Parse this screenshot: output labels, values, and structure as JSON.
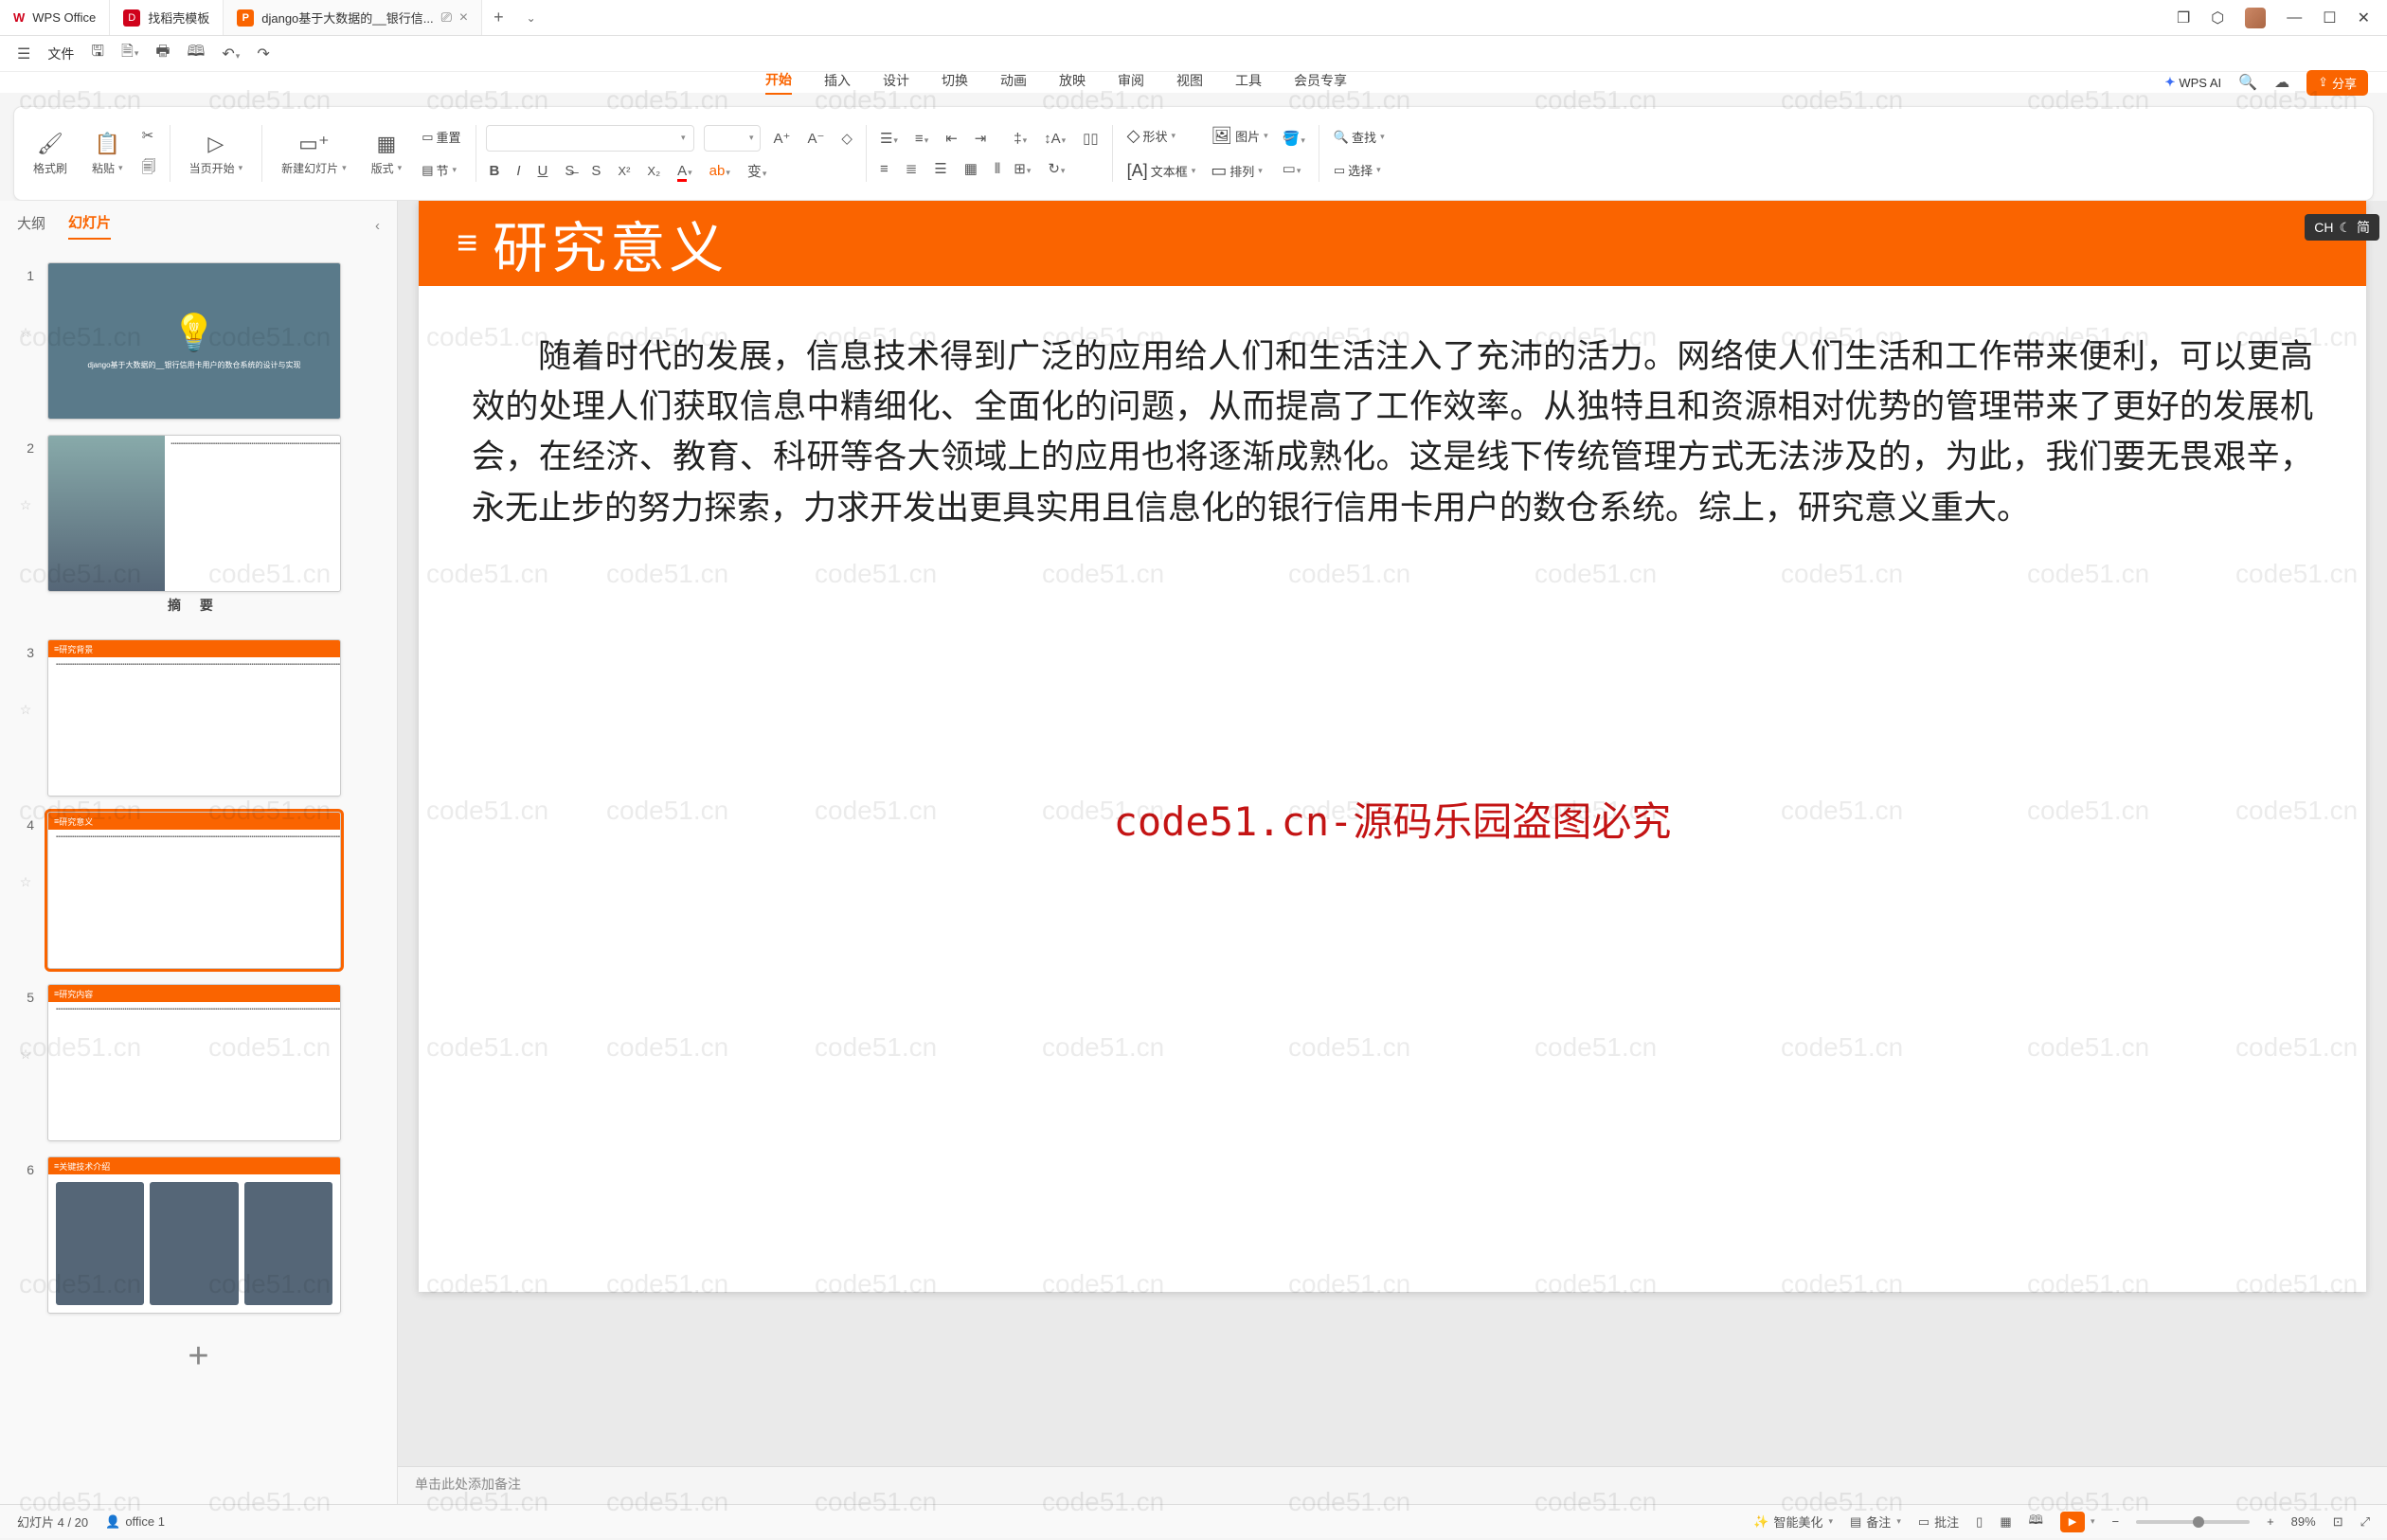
{
  "titlebar": {
    "app_name": "WPS Office",
    "tabs": [
      {
        "label": "找稻壳模板"
      },
      {
        "label": "django基于大数据的__银行信...",
        "active": true
      }
    ]
  },
  "quickbar": {
    "file_label": "文件"
  },
  "ribbon_tabs": [
    "开始",
    "插入",
    "设计",
    "切换",
    "动画",
    "放映",
    "审阅",
    "视图",
    "工具",
    "会员专享"
  ],
  "ribbon_active_tab": "开始",
  "wps_ai_label": "WPS AI",
  "share_label": "分享",
  "ribbon": {
    "format_brush": "格式刷",
    "paste": "粘贴",
    "from_current": "当页开始",
    "new_slide": "新建幻灯片",
    "layout": "版式",
    "section": "节",
    "reset": "重置",
    "shape": "形状",
    "picture": "图片",
    "textbox": "文本框",
    "arrange": "排列",
    "find": "查找",
    "select": "选择",
    "font_change": "变"
  },
  "side": {
    "outline_tab": "大纲",
    "slides_tab": "幻灯片",
    "slides": [
      {
        "n": 1,
        "kind": "title",
        "title": "django基于大数据的__银行信用卡用户的数仓系统的设计与实现"
      },
      {
        "n": 2,
        "kind": "abstract",
        "caption": "摘  要"
      },
      {
        "n": 3,
        "kind": "orange",
        "bar": "研究背景"
      },
      {
        "n": 4,
        "kind": "orange",
        "bar": "研究意义",
        "selected": true
      },
      {
        "n": 5,
        "kind": "orange",
        "bar": "研究内容"
      },
      {
        "n": 6,
        "kind": "orange",
        "bar": "关键技术介绍"
      }
    ]
  },
  "slide": {
    "title": "研究意义",
    "body": "随着时代的发展，信息技术得到广泛的应用给人们和生活注入了充沛的活力。网络使人们生活和工作带来便利，可以更高效的处理人们获取信息中精细化、全面化的问题，从而提高了工作效率。从独特且和资源相对优势的管理带来了更好的发展机会，在经济、教育、科研等各大领域上的应用也将逐渐成熟化。这是线下传统管理方式无法涉及的，为此，我们要无畏艰辛，永无止步的努力探索，力求开发出更具实用且信息化的银行信用卡用户的数仓系统。综上，研究意义重大。"
  },
  "watermark_center": "code51.cn-源码乐园盗图必究",
  "watermark_text": "code51.cn",
  "notes_placeholder": "单击此处添加备注",
  "ime": {
    "lang": "CH",
    "mode": "简"
  },
  "status": {
    "slide_pos": "幻灯片 4 / 20",
    "author": "office 1",
    "beautify": "智能美化",
    "notes": "备注",
    "review": "批注",
    "zoom": "89%"
  }
}
